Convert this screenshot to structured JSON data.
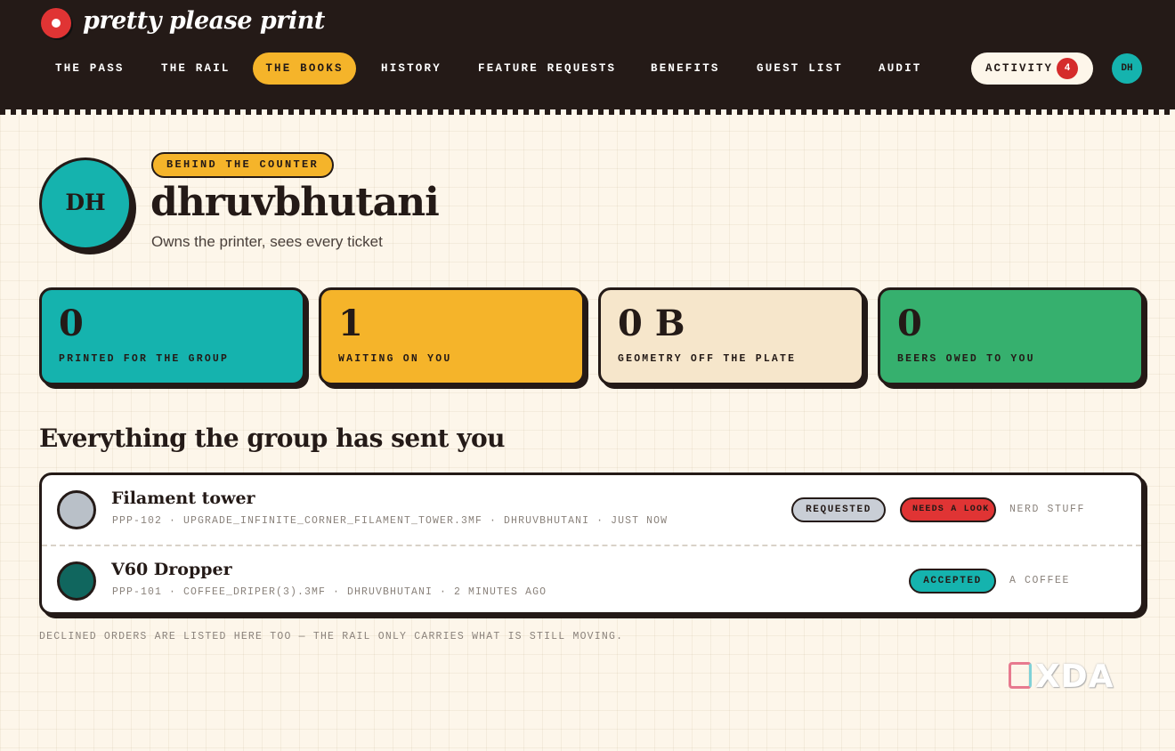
{
  "app": {
    "brand": "pretty please print"
  },
  "nav": [
    {
      "label": "THE PASS",
      "active": false
    },
    {
      "label": "THE RAIL",
      "active": false
    },
    {
      "label": "THE BOOKS",
      "active": true
    },
    {
      "label": "HISTORY",
      "active": false
    },
    {
      "label": "FEATURE REQUESTS",
      "active": false
    },
    {
      "label": "BENEFITS",
      "active": false
    },
    {
      "label": "GUEST LIST",
      "active": false
    },
    {
      "label": "AUDIT",
      "active": false
    }
  ],
  "activity": {
    "label": "ACTIVITY",
    "count": "4"
  },
  "user": {
    "initials": "DH",
    "role": "BEHIND THE COUNTER",
    "username": "dhruvbhutani",
    "subtitle": "Owns the printer, sees every ticket"
  },
  "stats": [
    {
      "value": "0",
      "label": "PRINTED FOR THE GROUP",
      "color": "#15b3ae"
    },
    {
      "value": "1",
      "label": "WAITING ON YOU",
      "color": "#f5b42a"
    },
    {
      "value": "0 B",
      "label": "GEOMETRY OFF THE PLATE",
      "color": "#f6e6cb"
    },
    {
      "value": "0",
      "label": "BEERS OWED TO YOU",
      "color": "#36b06e"
    }
  ],
  "section": {
    "title": "Everything the group has sent you"
  },
  "orders": [
    {
      "title": "Filament tower",
      "meta": "PPP-102 · UPGRADE_INFINITE_CORNER_FILAMENT_TOWER.3MF · DHRUVBHUTANI · JUST NOW",
      "dot_color": "#b9c0c8",
      "pills": [
        {
          "label": "REQUESTED",
          "bg": "#c9ced6",
          "fg": "#241a17"
        },
        {
          "label": "NEEDS A LOOK",
          "bg": "#e03434",
          "fg": "#241a17"
        }
      ],
      "tag": "NERD STUFF"
    },
    {
      "title": "V60 Dropper",
      "meta": "PPP-101 · COFFEE_DRIPER(3).3MF · DHRUVBHUTANI · 2 MINUTES AGO",
      "dot_color": "#10665e",
      "pills": [
        {
          "label": "ACCEPTED",
          "bg": "#15b3ae",
          "fg": "#241a17"
        }
      ],
      "tag": "A COFFEE"
    }
  ],
  "footnote": "DECLINED ORDERS ARE LISTED HERE TOO — THE RAIL ONLY CARRIES WHAT IS STILL MOVING.",
  "watermark": "XDA"
}
